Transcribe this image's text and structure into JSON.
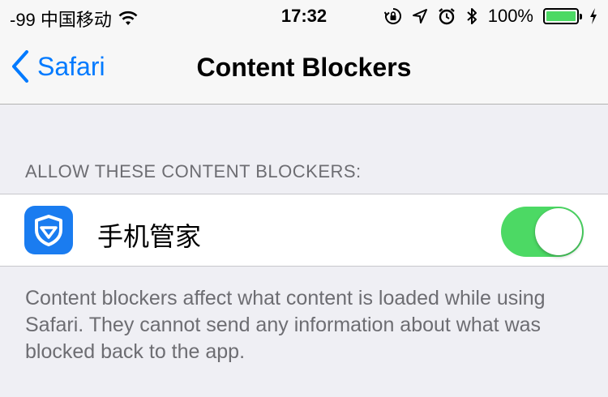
{
  "status_bar": {
    "carrier": "-99 中国移动",
    "time": "17:32",
    "battery_percent": "100%",
    "battery_level": 1.0,
    "icons": [
      "wifi-icon",
      "orientation-lock-icon",
      "location-icon",
      "alarm-icon",
      "bluetooth-icon",
      "battery-icon",
      "charging-icon"
    ]
  },
  "nav": {
    "back_label": "Safari",
    "title": "Content Blockers"
  },
  "section": {
    "header": "ALLOW THESE CONTENT BLOCKERS:",
    "items": [
      {
        "label": "手机管家",
        "icon": "tencent-shield-app-icon",
        "enabled": true
      }
    ],
    "footer": "Content blockers affect what content is loaded while using Safari. They cannot send any information about what was blocked back to the app."
  },
  "colors": {
    "accent": "#007aff",
    "toggle_on": "#4cd964",
    "app_icon": "#1a7cf0",
    "group_background": "#efeff4"
  }
}
